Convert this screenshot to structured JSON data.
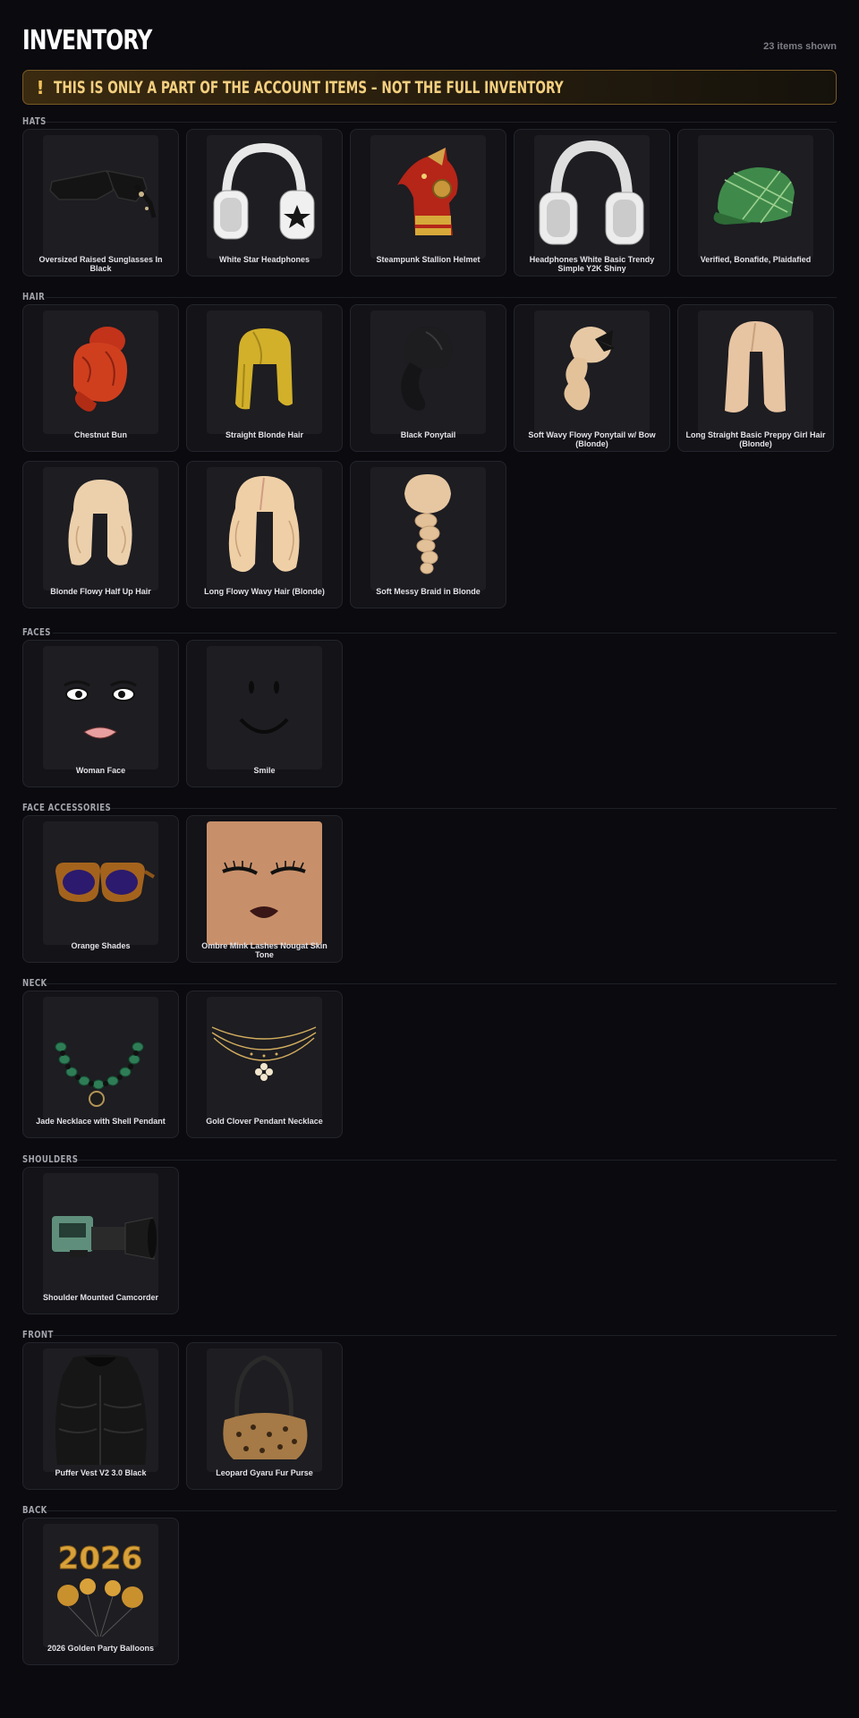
{
  "header": {
    "title": "INVENTORY",
    "count": "23 items shown"
  },
  "banner": {
    "icon": "exclamation-icon",
    "text": "THIS IS ONLY A PART OF THE ACCOUNT ITEMS – NOT THE FULL INVENTORY",
    "accent": "#f3cf7f"
  },
  "sections": {
    "hats": {
      "label": "HATS",
      "items": [
        {
          "name": "Oversized Raised Sunglasses In Black",
          "icon": "sunglasses-icon"
        },
        {
          "name": "White Star Headphones",
          "icon": "headphones-star-icon"
        },
        {
          "name": "Steampunk Stallion Helmet",
          "icon": "horse-helmet-icon"
        },
        {
          "name": "Headphones White Basic Trendy Simple Y2K Shiny",
          "icon": "headphones-icon"
        },
        {
          "name": "Verified, Bonafide, Plaidafied",
          "icon": "plaid-cap-icon"
        }
      ]
    },
    "hair": {
      "label": "HAIR",
      "items": [
        {
          "name": "Chestnut Bun",
          "icon": "bun-hair-icon"
        },
        {
          "name": "Straight Blonde Hair",
          "icon": "straight-hair-icon"
        },
        {
          "name": "Black Ponytail",
          "icon": "ponytail-icon"
        },
        {
          "name": "Soft Wavy Flowy Ponytail w/ Bow (Blonde)",
          "icon": "bow-ponytail-icon"
        },
        {
          "name": "Long Straight Basic Preppy Girl Hair (Blonde)",
          "icon": "long-hair-icon"
        },
        {
          "name": "Blonde Flowy Half Up Hair",
          "icon": "half-up-hair-icon"
        },
        {
          "name": "Long Flowy Wavy Hair (Blonde)",
          "icon": "wavy-hair-icon"
        },
        {
          "name": "Soft Messy Braid in Blonde",
          "icon": "braid-icon"
        }
      ]
    },
    "faces": {
      "label": "FACES",
      "items": [
        {
          "name": "Woman Face",
          "icon": "woman-face-icon"
        },
        {
          "name": "Smile",
          "icon": "smile-face-icon"
        }
      ]
    },
    "face_accessories": {
      "label": "FACE ACCESSORIES",
      "items": [
        {
          "name": "Orange Shades",
          "icon": "orange-shades-icon"
        },
        {
          "name": "Ombre Mink Lashes Nougat Skin Tone",
          "icon": "lashes-head-icon"
        }
      ]
    },
    "neck": {
      "label": "NECK",
      "items": [
        {
          "name": "Jade Necklace with Shell Pendant",
          "icon": "jade-necklace-icon"
        },
        {
          "name": "Gold Clover Pendant Necklace",
          "icon": "clover-necklace-icon"
        }
      ]
    },
    "shoulders": {
      "label": "SHOULDERS",
      "items": [
        {
          "name": "Shoulder Mounted Camcorder",
          "icon": "camcorder-icon"
        }
      ]
    },
    "front": {
      "label": "FRONT",
      "items": [
        {
          "name": "Puffer Vest V2 3.0 Black",
          "icon": "puffer-vest-icon"
        },
        {
          "name": "Leopard Gyaru Fur Purse",
          "icon": "leopard-purse-icon"
        }
      ]
    },
    "back": {
      "label": "BACK",
      "items": [
        {
          "name": "2026 Golden Party Balloons",
          "icon": "balloons-icon"
        }
      ]
    }
  }
}
